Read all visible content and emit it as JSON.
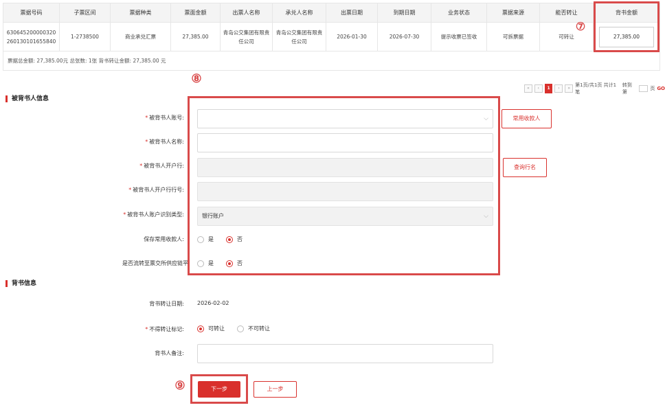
{
  "bill_table": {
    "headers": [
      "票据号码",
      "子票区间",
      "票据种类",
      "票面金额",
      "出票人名称",
      "承兑人名称",
      "出票日期",
      "到期日期",
      "业务状态",
      "票据来源",
      "能否转让",
      "背书金额"
    ],
    "row": {
      "bill_no": "630645200000320260130101655840",
      "sub_range": "1-2738500",
      "bill_type": "商业承兑汇票",
      "face_amount": "27,385.00",
      "drawer": "青岛公交集团有限责任公司",
      "acceptor": "青岛公交集团有限责任公司",
      "issue_date": "2026-01-30",
      "due_date": "2026-07-30",
      "status": "提示收票已签收",
      "source": "可拆票据",
      "transferable": "可转让",
      "endorse_amount": "27,385.00"
    },
    "summary": "票据总金额: 27,385.00元 总张数: 1张 背书转让金额: 27,385.00 元"
  },
  "pager": {
    "first": "«",
    "prev": "‹",
    "current": "1",
    "next": "›",
    "last": "»",
    "info": "第1页/共1页 共计1笔",
    "goto_label": "转到第",
    "page_unit": "页",
    "go": "GO"
  },
  "endorsee": {
    "title": "被背书人信息",
    "account_label": "被背书人账号:",
    "account_value": "",
    "name_label": "被背书人名称:",
    "name_value": "",
    "bank_label": "被背书人开户行:",
    "bank_value": "",
    "bank_no_label": "被背书人开户行行号:",
    "bank_no_value": "",
    "id_type_label": "被背书人账户识别类型:",
    "id_type_value": "银行账户",
    "save_payee_label": "保存常用收款人:",
    "flow_label": "是否流转至票交所供应链平台",
    "yes": "是",
    "no": "否",
    "common_payee_btn": "常用收款人",
    "query_bank_btn": "查询行名"
  },
  "endorsement": {
    "title": "背书信息",
    "date_label": "背书转让日期:",
    "date_value": "2026-02-02",
    "nontransfer_label": "不得转让标记:",
    "transferable": "可转让",
    "nontransferable": "不可转让",
    "remark_label": "背书人备注:",
    "remark_value": ""
  },
  "actions": {
    "next": "下一步",
    "prev": "上一步"
  },
  "annotations": {
    "n7": "⑦",
    "n8": "⑧",
    "n9": "⑨"
  },
  "colors": {
    "accent": "#d9302c",
    "highlight": "#d94a4a"
  }
}
